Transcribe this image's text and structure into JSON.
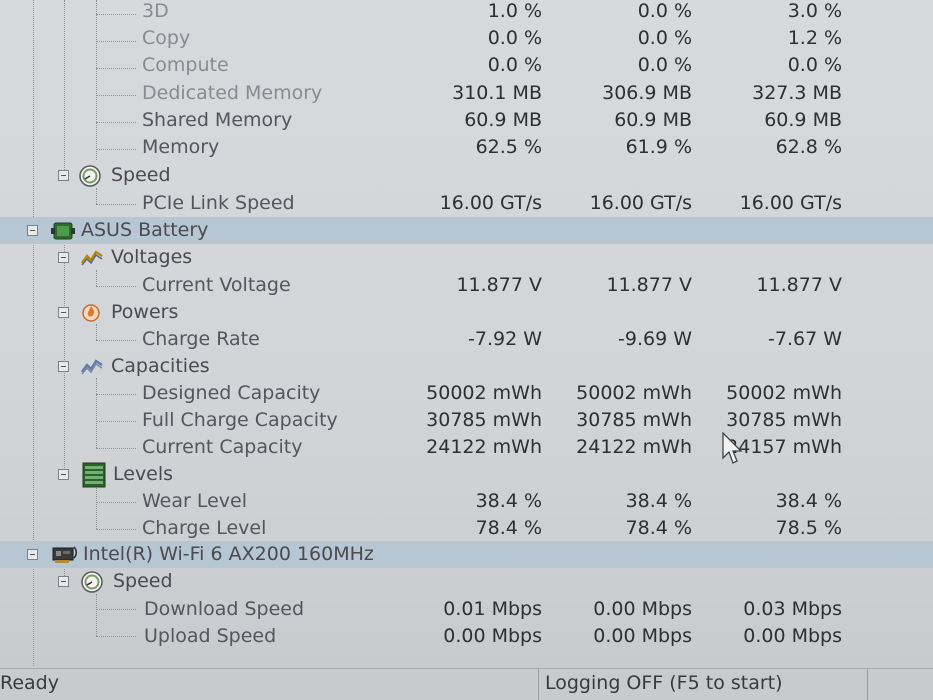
{
  "rows": [
    {
      "label": "3D",
      "v1": "1.0 %",
      "v2": "0.0 %",
      "v3": "3.0 %"
    },
    {
      "label": "Copy",
      "v1": "0.0 %",
      "v2": "0.0 %",
      "v3": "1.2 %"
    },
    {
      "label": "Compute",
      "v1": "0.0 %",
      "v2": "0.0 %",
      "v3": "0.0 %"
    },
    {
      "label": "Dedicated Memory",
      "v1": "310.1 MB",
      "v2": "306.9 MB",
      "v3": "327.3 MB"
    },
    {
      "label": "Shared Memory",
      "v1": "60.9 MB",
      "v2": "60.9 MB",
      "v3": "60.9 MB"
    },
    {
      "label": "Memory",
      "v1": "62.5 %",
      "v2": "61.9 %",
      "v3": "62.8 %"
    },
    {
      "label": "Speed"
    },
    {
      "label": "PCIe Link Speed",
      "v1": "16.00 GT/s",
      "v2": "16.00 GT/s",
      "v3": "16.00 GT/s"
    },
    {
      "label": "ASUS Battery"
    },
    {
      "label": "Voltages"
    },
    {
      "label": "Current Voltage",
      "v1": "11.877 V",
      "v2": "11.877 V",
      "v3": "11.877 V"
    },
    {
      "label": "Powers"
    },
    {
      "label": "Charge Rate",
      "v1": "-7.92 W",
      "v2": "-9.69 W",
      "v3": "-7.67 W"
    },
    {
      "label": "Capacities"
    },
    {
      "label": "Designed Capacity",
      "v1": "50002 mWh",
      "v2": "50002 mWh",
      "v3": "50002 mWh"
    },
    {
      "label": "Full Charge Capacity",
      "v1": "30785 mWh",
      "v2": "30785 mWh",
      "v3": "30785 mWh"
    },
    {
      "label": "Current Capacity",
      "v1": "24122 mWh",
      "v2": "24122 mWh",
      "v3": "24157 mWh"
    },
    {
      "label": "Levels"
    },
    {
      "label": "Wear Level",
      "v1": "38.4 %",
      "v2": "38.4 %",
      "v3": "38.4 %"
    },
    {
      "label": "Charge Level",
      "v1": "78.4 %",
      "v2": "78.4 %",
      "v3": "78.5 %"
    },
    {
      "label": "Intel(R) Wi-Fi 6 AX200 160MHz"
    },
    {
      "label": "Speed"
    },
    {
      "label": "Download Speed",
      "v1": "0.01 Mbps",
      "v2": "0.00 Mbps",
      "v3": "0.03 Mbps"
    },
    {
      "label": "Upload Speed",
      "v1": "0.00 Mbps",
      "v2": "0.00 Mbps",
      "v3": "0.00 Mbps"
    }
  ],
  "statusbar": {
    "ready": "Ready",
    "logging": "Logging OFF (F5 to start)"
  },
  "colors": {
    "device_row_highlight": "#b7c6d3",
    "background": "#d4d7da"
  },
  "icons": {
    "speed": "speedometer-icon",
    "battery": "battery-icon",
    "voltages": "voltage-graph-icon",
    "powers": "power-flame-icon",
    "capacities": "capacity-graph-icon",
    "levels": "level-bars-icon",
    "wifi": "network-card-icon"
  }
}
